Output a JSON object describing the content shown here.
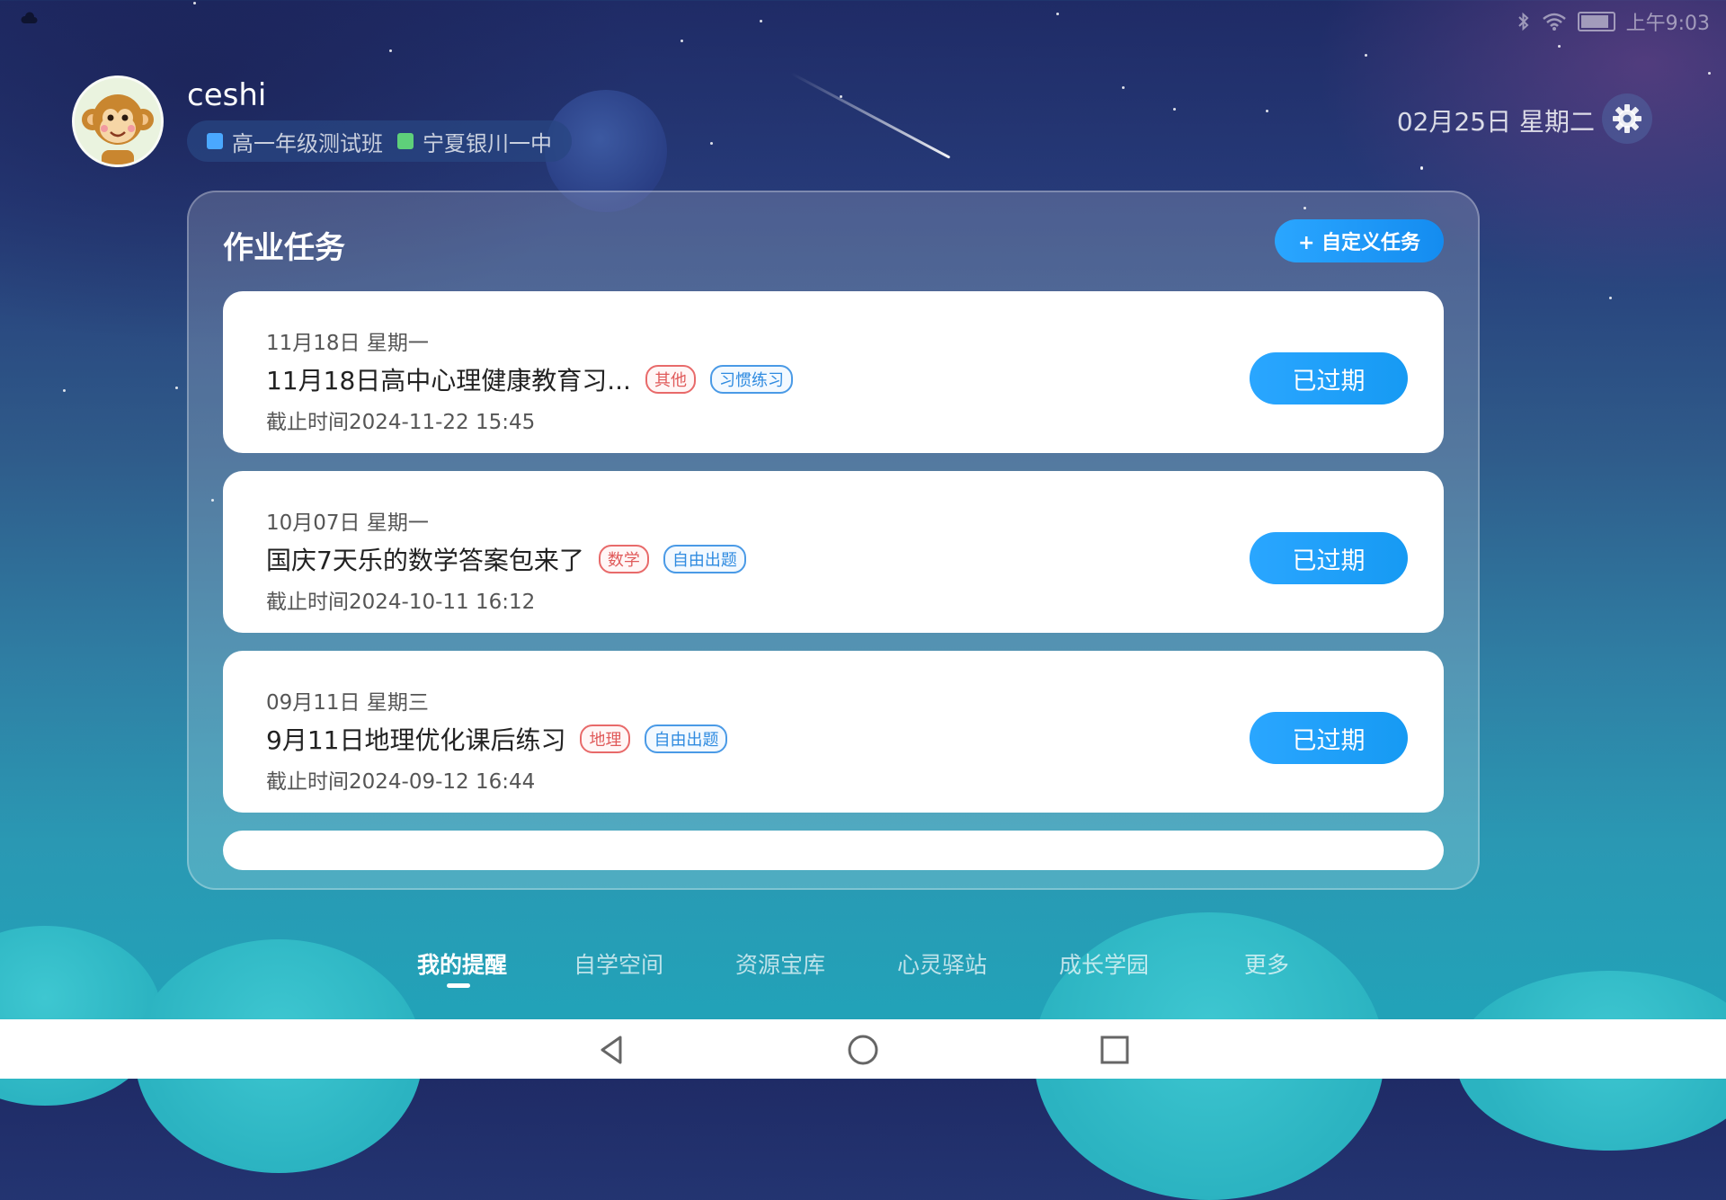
{
  "status_bar": {
    "time": "上午9:03",
    "icons": [
      "bluetooth-icon",
      "wifi-icon",
      "battery-icon"
    ]
  },
  "header": {
    "username": "ceshi",
    "class_name": "高一年级测试班",
    "school_name": "宁夏银川一中",
    "date": "02月25日 星期二",
    "settings_icon": "gear-icon"
  },
  "panel": {
    "title": "作业任务",
    "custom_task_label": "+ 自定义任务",
    "tasks": [
      {
        "date": "11月18日 星期一",
        "title": "11月18日高中心理健康教育习...",
        "tags": [
          "其他",
          "习惯练习"
        ],
        "deadline": "截止时间2024-11-22 15:45",
        "status": "已过期"
      },
      {
        "date": "10月07日 星期一",
        "title": "国庆7天乐的数学答案包来了",
        "tags": [
          "数学",
          "自由出题"
        ],
        "deadline": "截止时间2024-10-11 16:12",
        "status": "已过期"
      },
      {
        "date": "09月11日 星期三",
        "title": "9月11日地理优化课后练习",
        "tags": [
          "地理",
          "自由出题"
        ],
        "deadline": "截止时间2024-09-12 16:44",
        "status": "已过期"
      }
    ]
  },
  "bottom_nav": {
    "items": [
      "我的提醒",
      "自学空间",
      "资源宝库",
      "心灵驿站",
      "成长学园",
      "更多"
    ],
    "active": "我的提醒"
  },
  "system_nav": {
    "icons": [
      "back-icon",
      "home-icon",
      "recents-icon"
    ]
  },
  "colors": {
    "accent": "#1a9cf5",
    "tag_red": "#e05a5a",
    "tag_blue": "#2f8be0"
  }
}
